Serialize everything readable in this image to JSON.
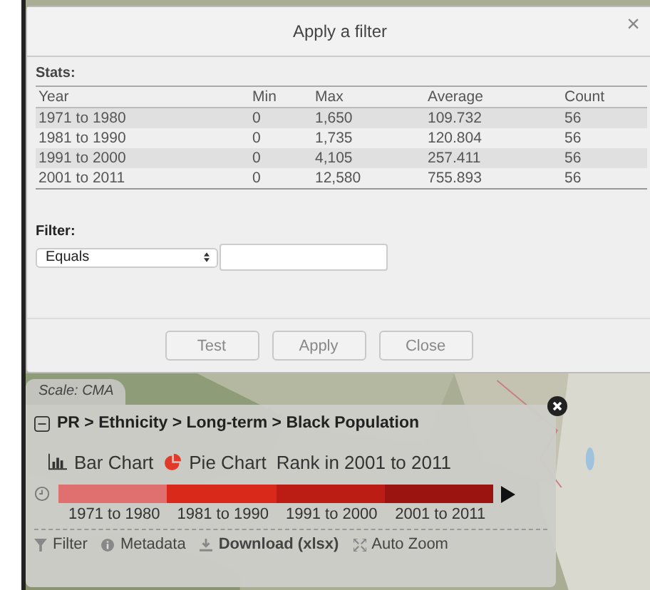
{
  "dialog": {
    "title": "Apply a filter",
    "close": "×",
    "stats_label": "Stats:",
    "columns": [
      "Year",
      "Min",
      "Max",
      "Average",
      "Count"
    ],
    "rows": [
      [
        "1971 to 1980",
        "0",
        "1,650",
        "109.732",
        "56"
      ],
      [
        "1981 to 1990",
        "0",
        "1,735",
        "120.804",
        "56"
      ],
      [
        "1991 to 2000",
        "0",
        "4,105",
        "257.411",
        "56"
      ],
      [
        "2001 to 2011",
        "0",
        "12,580",
        "755.893",
        "56"
      ]
    ],
    "filter_label": "Filter:",
    "operator": "Equals",
    "buttons": [
      "Test",
      "Apply",
      "Close"
    ]
  },
  "map": {
    "scale_tab": "Scale: CMA"
  },
  "panel": {
    "breadcrumb": "PR > Ethnicity > Long-term > Black Population",
    "chart_links": [
      {
        "kind": "bar",
        "label": "Bar Chart"
      },
      {
        "kind": "pie",
        "label": "Pie Chart"
      }
    ],
    "rank_text": "Rank in 2001 to 2011",
    "timeline": [
      {
        "label": "1971 to 1980",
        "color": "#e07070"
      },
      {
        "label": "1981 to 1990",
        "color": "#d8291b"
      },
      {
        "label": "1991 to 2000",
        "color": "#bb1d14"
      },
      {
        "label": "2001 to 2011",
        "color": "#9c1410"
      }
    ],
    "actions": [
      {
        "kind": "filter",
        "label": "Filter",
        "bold": false
      },
      {
        "kind": "info",
        "label": "Metadata",
        "bold": false
      },
      {
        "kind": "download",
        "label": "Download (xlsx)",
        "bold": true
      },
      {
        "kind": "zoom",
        "label": "Auto Zoom",
        "bold": false
      }
    ]
  }
}
